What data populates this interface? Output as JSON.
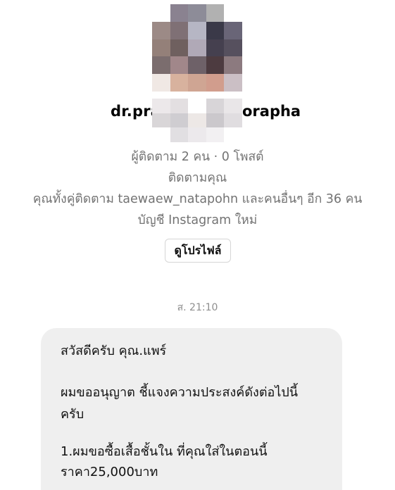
{
  "profile": {
    "name_prefix": "dr.pra",
    "name_suffix": "orapha",
    "stats": "ผู้ติดตาม 2 คน · 0 โพสต์",
    "follows_you": "ติดตามคุณ",
    "mutual": "คุณทั้งคู่ติดตาม taewaew_natapohn และคนอื่นๆ อีก 36 คน",
    "account_note": "บัญชี Instagram ใหม่",
    "view_profile_button": "ดูโปรไฟล์"
  },
  "chat": {
    "timestamp": "ส. 21:10",
    "message_lines": [
      "สวัสดีครับ คุณ.แพร์",
      "ผมขออนุญาต ชี้แจงความประสงค์ดังต่อไปนี้",
      "ครับ",
      "1.ผมขอซื้อเสื้อชั้นใน ที่คุณใส่ในตอนนี้",
      "ราคา25,000บาท"
    ]
  }
}
